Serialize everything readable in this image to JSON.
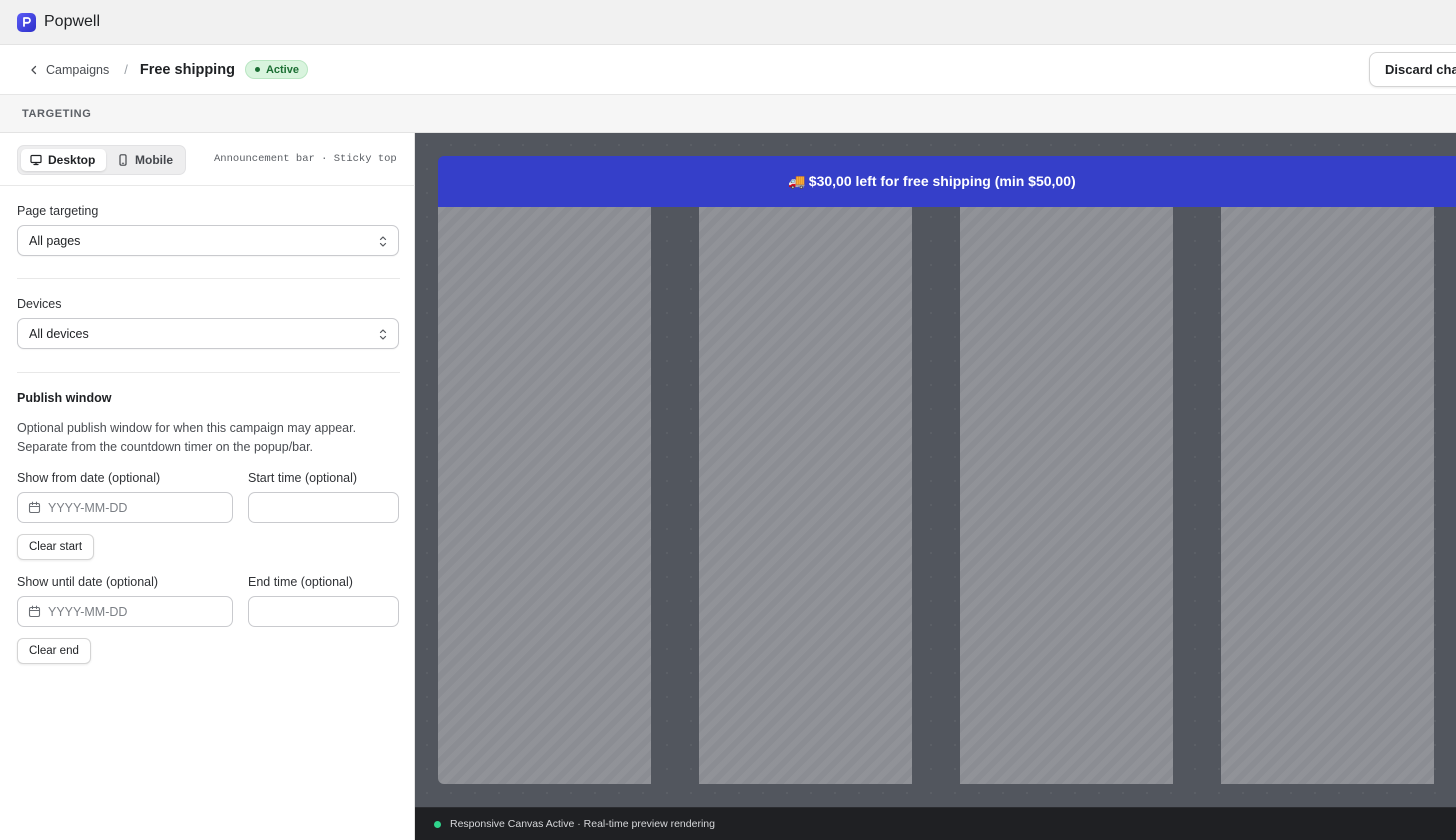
{
  "app": {
    "brand": "Popwell"
  },
  "header": {
    "back_label": "Campaigns",
    "separator": "/",
    "title": "Free shipping",
    "status": "Active",
    "discard_label": "Discard changes"
  },
  "section": {
    "label": "TARGETING"
  },
  "device_toggle": {
    "options": [
      {
        "label": "Desktop",
        "icon": "monitor-icon",
        "selected": true
      },
      {
        "label": "Mobile",
        "icon": "smartphone-icon",
        "selected": false
      }
    ],
    "mode_info": "Announcement bar · Sticky top"
  },
  "targeting": {
    "page_label": "Page targeting",
    "page_value": "All pages",
    "devices_label": "Devices",
    "devices_value": "All devices"
  },
  "publish": {
    "title": "Publish window",
    "description": "Optional publish window for when this campaign may appear. Separate from the countdown timer on the popup/bar.",
    "show_from_label": "Show from date (optional)",
    "start_time_label": "Start time (optional)",
    "date_placeholder": "YYYY-MM-DD",
    "clear_start": "Clear start",
    "show_until_label": "Show until date (optional)",
    "end_time_label": "End time (optional)",
    "clear_end": "Clear end"
  },
  "preview": {
    "bar_icon": "🚚",
    "bar_text": "$30,00 left for free shipping (min $50,00)",
    "bar_color": "#353fc9"
  },
  "status_bar": {
    "text": "Responsive Canvas Active · Real-time preview rendering",
    "dot_color": "#2fd58c"
  },
  "colors": {
    "canvas_bg": "#52565e",
    "active_badge_bg": "#d9f4de",
    "active_badge_text": "#1b6e33"
  }
}
